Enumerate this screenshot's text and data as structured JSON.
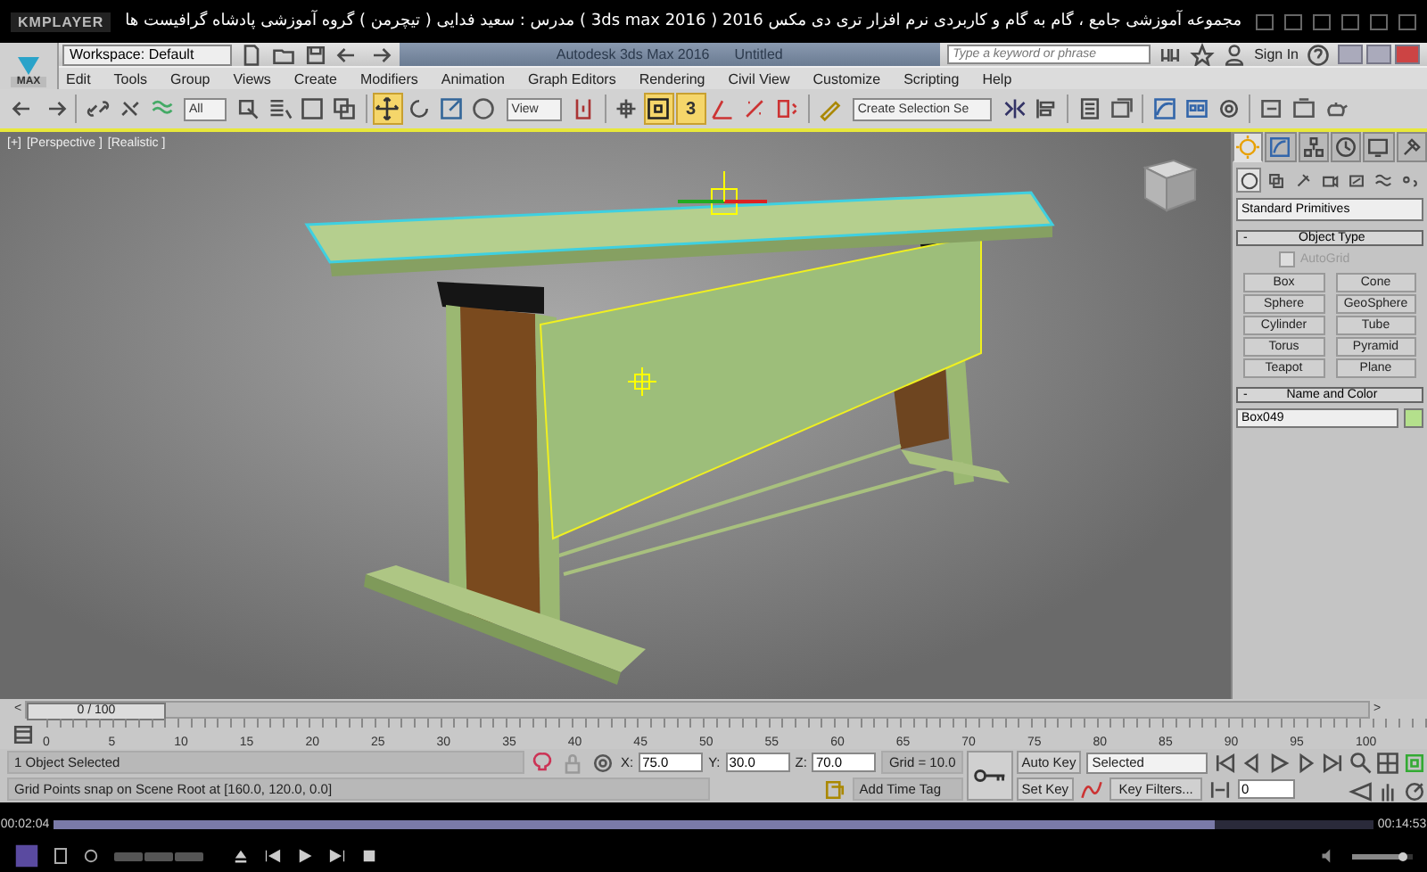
{
  "player": {
    "logo": "KMPLAYER",
    "video_title": "مجموعه آموزشی جامع ، گام به گام و کاربردی نرم افزار تری دی مکس 2016 ( 3ds max 2016 ) مدرس : سعید فدایی ( تیچرمن ) گروه آموزشی پادشاه گرافیست ها",
    "elapsed": "00:02:04",
    "duration": "00:14:53",
    "progress": {
      "level": 0.88
    },
    "volume": {
      "level": 0.85
    }
  },
  "max": {
    "app_button": "MAX",
    "workspace": "Workspace: Default",
    "title": "Autodesk 3ds Max 2016",
    "document": "Untitled",
    "search": {
      "placeholder": "Type a keyword or phrase"
    },
    "sign_in": "Sign In",
    "menu": [
      "Edit",
      "Tools",
      "Group",
      "Views",
      "Create",
      "Modifiers",
      "Animation",
      "Graph Editors",
      "Rendering",
      "Civil View",
      "Customize",
      "Scripting",
      "Help"
    ]
  },
  "toolbar": [
    {
      "kind": "tool",
      "selected": false
    },
    {
      "kind": "tool",
      "selected": false
    },
    {
      "kind": "separator"
    },
    {
      "kind": "tool",
      "selected": false
    },
    {
      "kind": "tool",
      "selected": false
    },
    {
      "kind": "tool",
      "selected": false
    },
    {
      "kind": "dropdown",
      "value": "All"
    },
    {
      "kind": "tool",
      "selected": false
    },
    {
      "kind": "tool",
      "selected": false
    },
    {
      "kind": "tool",
      "selected": false
    },
    {
      "kind": "tool",
      "selected": false
    },
    {
      "kind": "separator"
    },
    {
      "kind": "tool",
      "selected": true
    },
    {
      "kind": "tool",
      "selected": false
    },
    {
      "kind": "tool",
      "selected": false
    },
    {
      "kind": "tool",
      "selected": false
    },
    {
      "kind": "dropdown",
      "value": "View"
    },
    {
      "kind": "tool",
      "selected": false
    },
    {
      "kind": "separator"
    },
    {
      "kind": "tool",
      "selected": false
    },
    {
      "kind": "tool",
      "selected": true
    },
    {
      "kind": "snap",
      "label": "3",
      "selected": true
    },
    {
      "kind": "tool",
      "selected": false
    },
    {
      "kind": "tool",
      "selected": false
    },
    {
      "kind": "tool",
      "selected": false
    },
    {
      "kind": "separator"
    },
    {
      "kind": "tool",
      "selected": false
    },
    {
      "kind": "dropdown",
      "value": "Create Selection Se"
    },
    {
      "kind": "tool",
      "selected": false
    },
    {
      "kind": "tool",
      "selected": false
    },
    {
      "kind": "separator"
    },
    {
      "kind": "tool",
      "selected": false
    },
    {
      "kind": "tool",
      "selected": false
    },
    {
      "kind": "separator"
    },
    {
      "kind": "tool",
      "selected": false
    },
    {
      "kind": "tool",
      "selected": false
    },
    {
      "kind": "tool",
      "selected": false
    },
    {
      "kind": "separator"
    },
    {
      "kind": "tool",
      "selected": false
    },
    {
      "kind": "tool",
      "selected": false
    },
    {
      "kind": "tool",
      "selected": false
    }
  ],
  "viewport": {
    "labels": [
      "[+]",
      "[Perspective ]",
      "[Realistic ]"
    ]
  },
  "command_panel": {
    "tabs": [
      {
        "selected": true
      },
      {
        "selected": false
      },
      {
        "selected": false
      },
      {
        "selected": false
      },
      {
        "selected": false
      },
      {
        "selected": false
      }
    ],
    "subtabs": [
      {
        "selected": true
      },
      {
        "selected": false
      },
      {
        "selected": false
      },
      {
        "selected": false
      },
      {
        "selected": false
      },
      {
        "selected": false
      },
      {
        "selected": false
      }
    ],
    "category": "Standard Primitives",
    "object_type": {
      "toggle": "-",
      "title": "Object Type",
      "autogrid": {
        "label": "AutoGrid",
        "checked": false,
        "disabled": true
      },
      "buttons": [
        "Box",
        "Cone",
        "Sphere",
        "GeoSphere",
        "Cylinder",
        "Tube",
        "Torus",
        "Pyramid",
        "Teapot",
        "Plane"
      ]
    },
    "name_and_color": {
      "toggle": "-",
      "title": "Name and Color",
      "name": "Box049",
      "color": "#b4e08c"
    }
  },
  "timeline": {
    "prev": "<",
    "frame": "0 / 100",
    "next": ">",
    "level": 0,
    "ticks": [
      "0",
      "5",
      "10",
      "15",
      "20",
      "25",
      "30",
      "35",
      "40",
      "45",
      "50",
      "55",
      "60",
      "65",
      "70",
      "75",
      "80",
      "85",
      "90",
      "95",
      "100"
    ]
  },
  "status": {
    "selection": "1 Object Selected",
    "prompt": "Grid Points snap on Scene Root at [160.0, 120.0, 0.0]",
    "coords": [
      {
        "label": "X:",
        "value": "75.0"
      },
      {
        "label": "Y:",
        "value": "30.0"
      },
      {
        "label": "Z:",
        "value": "70.0"
      }
    ],
    "grid": "Grid = 10.0",
    "add_time_tag": "Add Time Tag",
    "auto_key": "Auto Key",
    "key_mode": "Selected",
    "set_key": "Set Key",
    "key_filters": "Key Filters...",
    "frame": "0"
  }
}
